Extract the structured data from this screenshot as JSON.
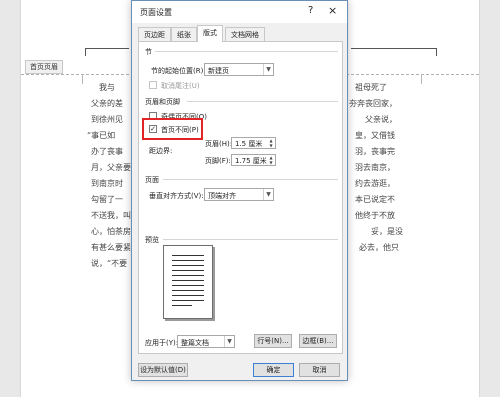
{
  "document": {
    "first_page_header_tag": "首页页眉",
    "lines": [
      "我与",
      "父亲的差",
      "到徐州见",
      "“事已如",
      "办了丧事",
      "月，父亲要",
      "到南京时",
      "勾留了一",
      "不送我，叫",
      "心，怕茶房",
      "有甚么要紧",
      "说，“不要"
    ],
    "right_lines": [
      "祖母死了",
      "夯奔丧回家，",
      "父亲说，",
      "皇，又借钱",
      "羽，丧事完",
      "羽去南京，",
      "约去游逛，",
      "本已说定不",
      "他终于不放",
      "妥，是没",
      "必去，他只"
    ]
  },
  "dialog": {
    "title": "页面设置",
    "help": "?",
    "close": "×",
    "tabs": [
      "页边距",
      "纸张",
      "版式",
      "文档网格"
    ],
    "active_tab": "版式",
    "section_section": {
      "heading": "节",
      "start_label": "节的起始位置(R):",
      "start_value": "新建页",
      "cancel_endnote": "取消尾注(U)"
    },
    "header_footer": {
      "heading": "页眉和页脚",
      "odd_even": "奇偶页不同(O)",
      "first_page": "首页不同(P)",
      "first_page_checked": true,
      "distance_label": "距边界:",
      "header_label": "页眉(H):",
      "header_value": "1.5 厘米",
      "footer_label": "页脚(F):",
      "footer_value": "1.75 厘米"
    },
    "page": {
      "heading": "页面",
      "valign_label": "垂直对齐方式(V):",
      "valign_value": "顶端对齐"
    },
    "preview": {
      "heading": "预览"
    },
    "apply": {
      "label": "应用于(Y):",
      "value": "整篇文档"
    },
    "buttons": {
      "line_numbers": "行号(N)...",
      "borders": "边框(B)...",
      "set_default": "设为默认值(D)",
      "ok": "确定",
      "cancel": "取消"
    }
  }
}
